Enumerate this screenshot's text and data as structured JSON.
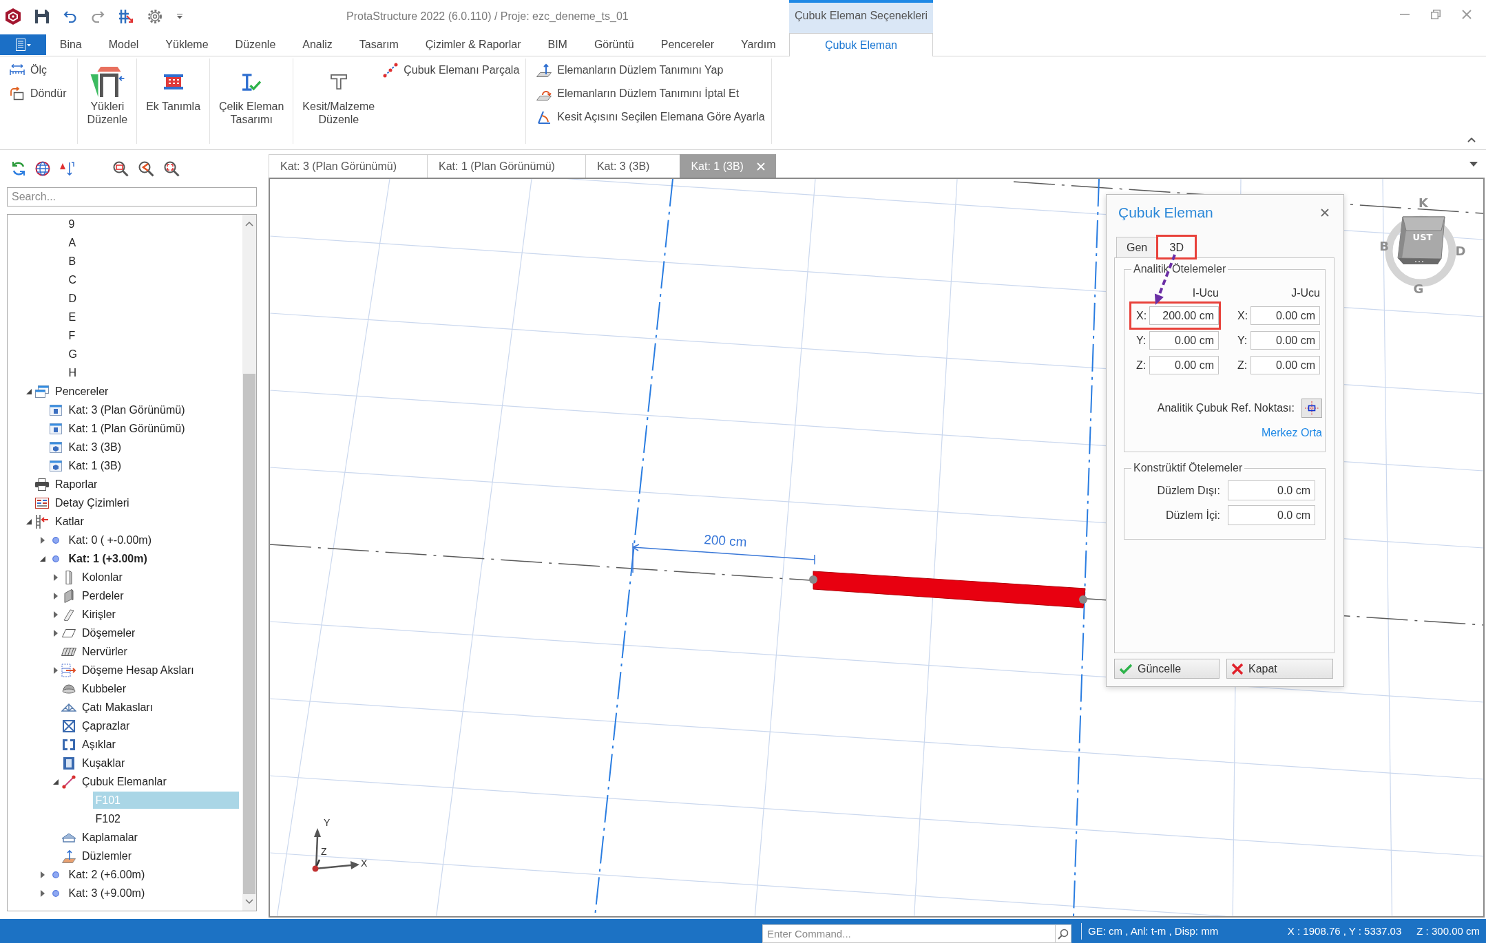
{
  "titlebar": {
    "title": "ProtaStructure 2022 (6.0.110) / Proje: ezc_deneme_ts_01",
    "context_header": "Çubuk Eleman Seçenekleri"
  },
  "ribbon": {
    "tabs": [
      {
        "label": "Bina",
        "kind": "normal",
        "selected": false
      },
      {
        "label": "Model",
        "kind": "normal",
        "selected": false
      },
      {
        "label": "Yükleme",
        "kind": "normal",
        "selected": false
      },
      {
        "label": "Düzenle",
        "kind": "normal",
        "selected": false
      },
      {
        "label": "Analiz",
        "kind": "normal",
        "selected": false
      },
      {
        "label": "Tasarım",
        "kind": "normal",
        "selected": false
      },
      {
        "label": "Çizimler & Raporlar",
        "kind": "normal",
        "selected": false
      },
      {
        "label": "BIM",
        "kind": "normal",
        "selected": false
      },
      {
        "label": "Görüntü",
        "kind": "normal",
        "selected": false
      },
      {
        "label": "Pencereler",
        "kind": "normal",
        "selected": false
      },
      {
        "label": "Yardım",
        "kind": "normal",
        "selected": false
      },
      {
        "label": "Çubuk Eleman",
        "kind": "contextual",
        "selected": true
      }
    ],
    "groups": [
      {
        "small": [
          {
            "label": "Ölç",
            "kind": "measure"
          },
          {
            "label": "Döndür",
            "kind": "rotate"
          }
        ]
      },
      {
        "large": [
          {
            "label": "Yükleri\nDüzenle",
            "kind": "loads"
          }
        ]
      },
      {
        "large": [
          {
            "label": "Ek Tanımla",
            "kind": "connection"
          }
        ]
      },
      {
        "large": [
          {
            "label": "Çelik Eleman\nTasarımı",
            "kind": "steel"
          }
        ]
      },
      {
        "large": [
          {
            "label": "Kesit/Malzeme\nDüzenle",
            "kind": "section"
          }
        ],
        "small": [
          {
            "label": "Çubuk Elemanı Parçala",
            "kind": "split"
          }
        ]
      },
      {
        "small": [
          {
            "label": "Elemanların Düzlem Tanımını Yap",
            "kind": "plane"
          },
          {
            "label": "Elemanların Düzlem Tanımını İptal Et",
            "kind": "unplane"
          },
          {
            "label": "Kesit Açısını Seçilen Elemana Göre Ayarla",
            "kind": "angle"
          }
        ]
      }
    ]
  },
  "explorer": {
    "search": {
      "placeholder": "Search..."
    },
    "tree": {
      "continued_items": [
        {
          "label": "9",
          "selected": false
        },
        {
          "label": "A",
          "selected": false
        },
        {
          "label": "B",
          "selected": false
        },
        {
          "label": "C",
          "selected": false
        },
        {
          "label": "D",
          "selected": false
        },
        {
          "label": "E",
          "selected": false
        },
        {
          "label": "F",
          "selected": false
        },
        {
          "label": "G",
          "selected": false
        },
        {
          "label": "H",
          "selected": false
        }
      ],
      "items": [
        {
          "label": "Pencereler",
          "kind": "windows",
          "expanded": true,
          "selected": false,
          "children": [
            {
              "label": "Kat: 3 (Plan Görünümü)",
              "kind": "plan",
              "selected": false
            },
            {
              "label": "Kat: 1 (Plan Görünümü)",
              "kind": "plan",
              "selected": false
            },
            {
              "label": "Kat: 3 (3B)",
              "kind": "perspective",
              "selected": false
            },
            {
              "label": "Kat: 1 (3B)",
              "kind": "perspective",
              "selected": false
            }
          ]
        },
        {
          "label": "Raporlar",
          "kind": "reports",
          "selected": false
        },
        {
          "label": "Detay Çizimleri",
          "kind": "drawings",
          "selected": false
        },
        {
          "label": "Katlar",
          "kind": "floors",
          "expanded": true,
          "selected": false,
          "children": [
            {
              "label": "Kat: 0 ( +-0.00m)",
              "kind": "floor",
              "expanded": false,
              "current": false,
              "selected": false
            },
            {
              "label": "Kat: 1 (+3.00m)",
              "kind": "floor",
              "expanded": true,
              "current": true,
              "selected": false,
              "children": [
                {
                  "label": "Kolonlar",
                  "kind": "columns",
                  "expanded": false,
                  "selected": false
                },
                {
                  "label": "Perdeler",
                  "kind": "walls",
                  "expanded": false,
                  "selected": false
                },
                {
                  "label": "Kirişler",
                  "kind": "beams",
                  "expanded": false,
                  "selected": false
                },
                {
                  "label": "Döşemeler",
                  "kind": "slabs",
                  "expanded": false,
                  "selected": false
                },
                {
                  "label": "Nervürler",
                  "kind": "ribs",
                  "selected": false
                },
                {
                  "label": "Döşeme Hesap Aksları",
                  "kind": "axes",
                  "expanded": false,
                  "selected": false
                },
                {
                  "label": "Kubbeler",
                  "kind": "domes",
                  "selected": false
                },
                {
                  "label": "Çatı Makasları",
                  "kind": "trusses",
                  "selected": false
                },
                {
                  "label": "Çaprazlar",
                  "kind": "braces",
                  "selected": false
                },
                {
                  "label": "Aşıklar",
                  "kind": "purlins",
                  "selected": false
                },
                {
                  "label": "Kuşaklar",
                  "kind": "girts",
                  "selected": false
                },
                {
                  "label": "Çubuk Elemanlar",
                  "kind": "members",
                  "expanded": true,
                  "selected": false,
                  "children": [
                    {
                      "label": "F101",
                      "selected": true
                    },
                    {
                      "label": "F102",
                      "selected": false
                    }
                  ]
                },
                {
                  "label": "Kaplamalar",
                  "kind": "cladding",
                  "selected": false
                },
                {
                  "label": "Düzlemler",
                  "kind": "planes",
                  "selected": false
                }
              ]
            },
            {
              "label": "Kat: 2 (+6.00m)",
              "kind": "floor",
              "expanded": false,
              "current": false,
              "selected": false
            },
            {
              "label": "Kat: 3 (+9.00m)",
              "kind": "floor",
              "expanded": false,
              "current": false,
              "selected": false
            }
          ]
        }
      ]
    }
  },
  "documents": {
    "tabs": [
      {
        "label": "Kat: 3 (Plan Görünümü)",
        "selected": false
      },
      {
        "label": "Kat: 1 (Plan Görünümü)",
        "selected": false
      },
      {
        "label": "Kat: 3 (3B)",
        "selected": false
      },
      {
        "label": "Kat: 1 (3B)",
        "selected": true
      }
    ]
  },
  "viewport": {
    "dimension_label": "200 cm",
    "view_cube": {
      "face_label": "UST",
      "top_label": "K",
      "left_label": "B",
      "right_label": "D",
      "bottom_label": "G"
    },
    "axes": {
      "y_label": "Y",
      "z_label": "Z",
      "x_label": "X"
    }
  },
  "dialog": {
    "title": "Çubuk Eleman",
    "annotation_arrow": true,
    "tabs": [
      {
        "label": "Gen",
        "selected": false,
        "highlighted": false
      },
      {
        "label": "3D",
        "selected": true,
        "highlighted": true
      }
    ],
    "analytic_group": {
      "legend": "Analitik Ötelemeler",
      "columns": [
        {
          "heading": "I-Ucu",
          "fields": [
            {
              "label": "X:",
              "value": "200.00 cm",
              "highlighted": true
            },
            {
              "label": "Y:",
              "value": "0.00 cm",
              "highlighted": false
            },
            {
              "label": "Z:",
              "value": "0.00 cm",
              "highlighted": false
            }
          ]
        },
        {
          "heading": "J-Ucu",
          "fields": [
            {
              "label": "X:",
              "value": "0.00 cm",
              "highlighted": false
            },
            {
              "label": "Y:",
              "value": "0.00 cm",
              "highlighted": false
            },
            {
              "label": "Z:",
              "value": "0.00 cm",
              "highlighted": false
            }
          ]
        }
      ],
      "ref_point_label": "Analitik Çubuk Ref. Noktası:",
      "ref_point_value": "Merkez Orta"
    },
    "constructive_group": {
      "legend": "Konstrüktif Ötelemeler",
      "fields": [
        {
          "label": "Düzlem Dışı:",
          "value": "0.0 cm"
        },
        {
          "label": "Düzlem İçi:",
          "value": "0.0 cm"
        }
      ]
    },
    "buttons": [
      {
        "label": "Güncelle",
        "kind": "apply"
      },
      {
        "label": "Kapat",
        "kind": "close"
      }
    ]
  },
  "status_bar": {
    "command": {
      "placeholder": "Enter Command..."
    },
    "units": "GE: cm , Anl: t-m , Disp: mm",
    "coordinates": "X : 1908.76 , Y : 5337.03",
    "elevation": "Z : 300.00 cm"
  }
}
